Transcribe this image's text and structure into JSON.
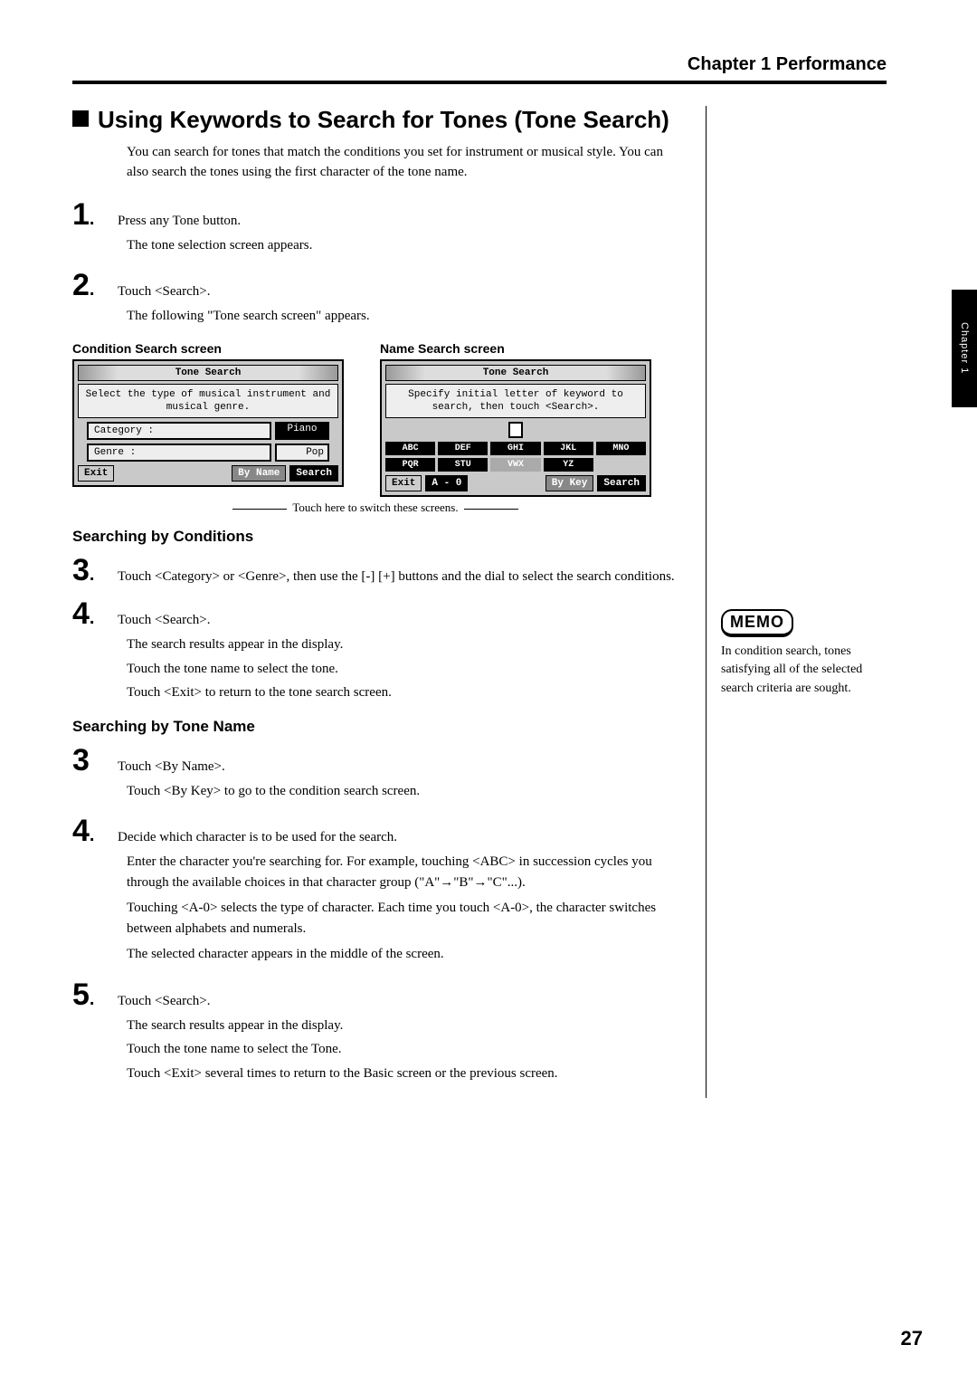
{
  "chapter_header": "Chapter 1 Performance",
  "side_tab": "Chapter 1",
  "section_title": "Using Keywords to Search for Tones (Tone Search)",
  "intro": "You can search for tones that match the conditions you set for instrument or musical style. You can also search the tones using the first character of the tone name.",
  "steps": {
    "s1": {
      "num": "1",
      "title": "Press any Tone button.",
      "expl": "The tone selection screen appears."
    },
    "s2": {
      "num": "2",
      "title": "Touch <Search>.",
      "expl": "The following \"Tone search screen\" appears."
    }
  },
  "screens": {
    "cond": {
      "caption": "Condition Search screen",
      "title": "Tone Search",
      "msg": "Select the type of musical instrument and musical genre.",
      "cat_label": "Category :",
      "cat_value": "Piano",
      "genre_label": "Genre   :",
      "genre_value": "Pop",
      "exit": "Exit",
      "byname": "By Name",
      "search": "Search"
    },
    "name": {
      "caption": "Name Search screen",
      "title": "Tone Search",
      "msg": "Specify initial letter of keyword to search, then touch <Search>.",
      "keys": [
        "ABC",
        "DEF",
        "GHI",
        "JKL",
        "MNO",
        "PQR",
        "STU",
        "VWX",
        "YZ"
      ],
      "exit": "Exit",
      "a0": "A - 0",
      "bykey": "By Key",
      "search": "Search"
    }
  },
  "switch_note": "Touch here to switch these screens.",
  "sub1": "Searching by Conditions",
  "s3": {
    "num": "3",
    "title": "Touch <Category> or <Genre>, then use the [-] [+] buttons and the dial to select the search conditions."
  },
  "s4": {
    "num": "4",
    "title": "Touch <Search>.",
    "e1": "The search results appear in the display.",
    "e2": "Touch the tone name to select the tone.",
    "e3": "Touch <Exit> to return to the tone search screen."
  },
  "sub2": "Searching by Tone Name",
  "s3b": {
    "num": "3",
    "title": "Touch <By Name>.",
    "e1": "Touch <By Key> to go to the condition search screen."
  },
  "s4b": {
    "num": "4",
    "title": "Decide which character is to be used for the search.",
    "e1": "Enter the character you're searching for. For example, touching <ABC> in succession cycles you through the available choices in that character group (\"A\"→\"B\"→\"C\"...).",
    "e2": "Touching <A-0> selects the type of character. Each time you touch <A-0>, the character switches between alphabets and numerals.",
    "e3": "The selected character appears in the middle of the screen."
  },
  "s5": {
    "num": "5",
    "title": "Touch <Search>.",
    "e1": "The search results appear in the display.",
    "e2": "Touch the tone name to select the Tone.",
    "e3": "Touch <Exit> several times to return to the Basic screen or the previous screen."
  },
  "memo": {
    "label": "MEMO",
    "text": "In condition search, tones satisfying all of the selected search criteria are sought."
  },
  "page_num": "27"
}
